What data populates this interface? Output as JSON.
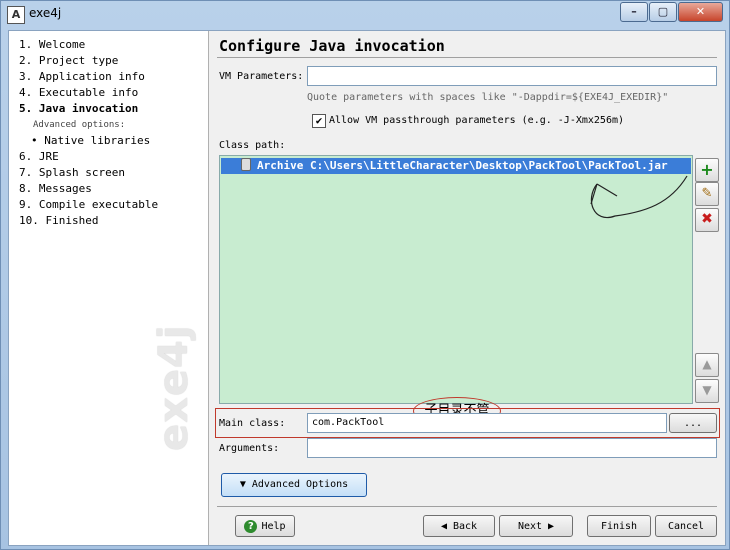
{
  "window": {
    "title": "exe4j",
    "app_icon": "A",
    "minimize": "–",
    "maximize": "▢",
    "close": "✕"
  },
  "steps": [
    "1. Welcome",
    "2. Project type",
    "3. Application info",
    "4. Executable info",
    "5. Java invocation",
    "6. JRE",
    "7. Splash screen",
    "8. Messages",
    "9. Compile executable",
    "10. Finished"
  ],
  "advanced_options_label": "Advanced options:",
  "sub_item": "• Native libraries",
  "watermark": "exe4j",
  "heading": "Configure Java invocation",
  "vm": {
    "label": "VM Parameters:",
    "value": "",
    "hint": "Quote parameters with spaces like \"-Dappdir=${EXE4J_EXEDIR}\""
  },
  "passthrough": {
    "checked": "✔",
    "label": "Allow VM passthrough parameters (e.g. -J-Xmx256m)"
  },
  "classpath": {
    "label": "Class path:",
    "entry": "Archive C:\\Users\\LittleCharacter\\Desktop\\PackTool\\PackTool.jar"
  },
  "side_buttons": {
    "add": "+",
    "edit": "✎",
    "remove": "✖",
    "up": "▲",
    "down": "▼"
  },
  "annotation": "子目录不管",
  "main_class": {
    "label": "Main class:",
    "value": "com.PackTool",
    "browse": "..."
  },
  "arguments": {
    "label": "Arguments:",
    "value": ""
  },
  "advanced_button": "▼  Advanced Options",
  "buttons": {
    "help": "Help",
    "back": "◀  Back",
    "next": "Next  ▶",
    "finish": "Finish",
    "cancel": "Cancel"
  },
  "colors": {
    "classpath_bg": "#c8ecd0",
    "selection": "#3b7dd8",
    "annotation": "#c0392b"
  }
}
